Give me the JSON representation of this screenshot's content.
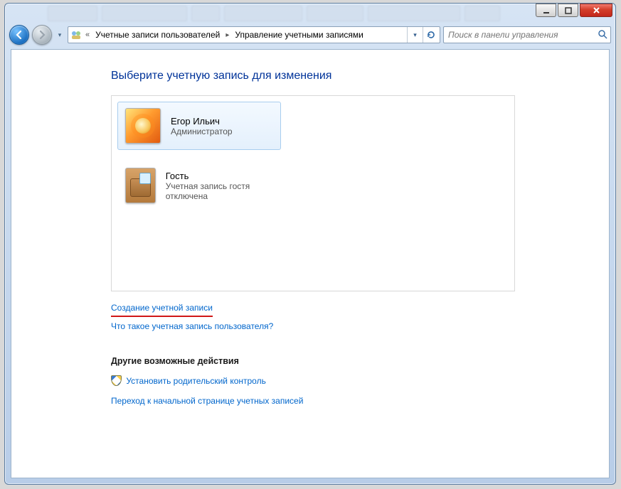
{
  "window": {
    "min_tip": "Свернуть",
    "max_tip": "Развернуть",
    "close_tip": "Закрыть"
  },
  "nav": {
    "back_tip": "Назад",
    "fwd_tip": "Вперёд"
  },
  "breadcrumb": {
    "prefix": "«",
    "item1": "Учетные записи пользователей",
    "item2": "Управление учетными записями"
  },
  "search": {
    "placeholder": "Поиск в панели управления"
  },
  "page": {
    "title": "Выберите учетную запись для изменения"
  },
  "accounts": [
    {
      "name": "Егор Ильич",
      "role": "Администратор"
    },
    {
      "name": "Гость",
      "role": "Учетная запись гостя отключена"
    }
  ],
  "links": {
    "create": "Создание учетной записи",
    "what_is": "Что такое учетная запись пользователя?"
  },
  "other": {
    "heading": "Другие возможные действия",
    "parental": "Установить родительский контроль",
    "goto_main": "Переход к начальной странице учетных записей"
  }
}
